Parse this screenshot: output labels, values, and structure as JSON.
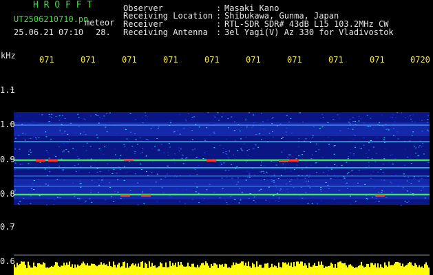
{
  "header": {
    "brand": "H R O F F T",
    "filename": "UT2506210710.pn",
    "mode": "meteor",
    "datetime": "25.06.21 07:10",
    "count": "28.",
    "fields": [
      {
        "label": "Observer",
        "sep": ":",
        "value": "Masaki Kano"
      },
      {
        "label": "Receiving Location",
        "sep": ":",
        "value": "Shibukawa, Gunma, Japan"
      },
      {
        "label": "Receiver",
        "sep": ":",
        "value": "RTL-SDR SDR# 43dB L15 103.2MHz CW"
      },
      {
        "label": "Receiving Antenna",
        "sep": ":",
        "value": "3el Yagi(V) Az 330 for Vladivostok"
      }
    ]
  },
  "axis": {
    "unit": "kHz",
    "y_ticks": [
      "1.1",
      "1.0",
      "0.9",
      "0.8",
      "0.7",
      "0.6"
    ],
    "x_ticks": [
      "071",
      "071",
      "071",
      "071",
      "071",
      "071",
      "071",
      "071",
      "071",
      "0720"
    ]
  },
  "colors": {
    "background": "#000000",
    "header_green": "#3cdc3c",
    "header_white": "#e6e6e6",
    "time_yellow": "#f0e650",
    "noise_blue": "#1e28dc",
    "signal_red": "#ff3c28",
    "histogram_yellow": "#ffff00"
  }
}
